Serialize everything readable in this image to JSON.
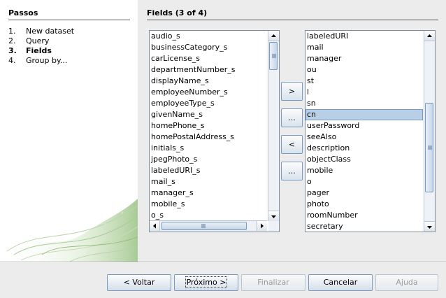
{
  "steps": {
    "title": "Passos",
    "items": [
      {
        "num": "1.",
        "label": "New dataset"
      },
      {
        "num": "2.",
        "label": "Query"
      },
      {
        "num": "3.",
        "label": "Fields"
      },
      {
        "num": "4.",
        "label": "Group by..."
      }
    ],
    "active_index": 2
  },
  "main": {
    "title": "Fields  (3 of 4)",
    "available_fields": [
      "audio_s",
      "businessCategory_s",
      "carLicense_s",
      "departmentNumber_s",
      "displayName_s",
      "employeeNumber_s",
      "employeeType_s",
      "givenName_s",
      "homePhone_s",
      "homePostalAddress_s",
      "initials_s",
      "jpegPhoto_s",
      "labeledURI_s",
      "mail_s",
      "manager_s",
      "mobile_s",
      "o_s"
    ],
    "selected_fields": [
      "labeledURI",
      "mail",
      "manager",
      "ou",
      "st",
      "l",
      "sn",
      "cn",
      "userPassword",
      "seeAlso",
      "description",
      "objectClass",
      "mobile",
      "o",
      "pager",
      "photo",
      "roomNumber",
      "secretary"
    ],
    "selected_fields_highlight": "cn",
    "move_buttons": {
      "add_one": ">",
      "add_all": "...",
      "remove_one": "<",
      "remove_all": "..."
    }
  },
  "footer": {
    "back": "< Voltar",
    "next": "Próximo >",
    "finish": "Finalizar",
    "cancel": "Cancelar",
    "help": "Ajuda"
  }
}
